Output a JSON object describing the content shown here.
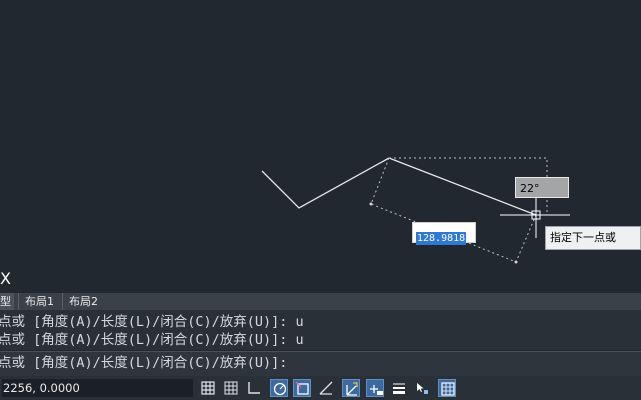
{
  "canvas": {
    "axis_label": "X",
    "angle_tooltip": "22°",
    "length_value": "128.9818",
    "prompt_tooltip": "指定下一点或"
  },
  "tabs": {
    "model": "型",
    "layout1": "布局1",
    "layout2": "布局2"
  },
  "command_history": [
    "点或 [角度(A)/长度(L)/闭合(C)/放弃(U)]: u",
    "点或 [角度(A)/长度(L)/闭合(C)/放弃(U)]: u"
  ],
  "command_prompt": "点或 [角度(A)/长度(L)/闭合(C)/放弃(U)]:",
  "status": {
    "coordinates": "2256, 0.0000"
  },
  "colors": {
    "canvas_bg": "#212830",
    "toggle_active": "#3d6a9e",
    "selection": "#2e79d6"
  }
}
